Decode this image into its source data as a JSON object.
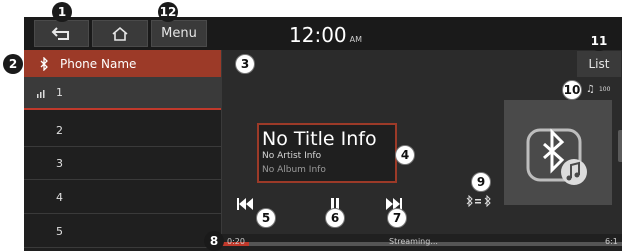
{
  "topbar": {
    "menu_label": "Menu",
    "clock": "12:00",
    "clock_suffix": "AM"
  },
  "source": {
    "phone_name": "Phone Name",
    "list_label": "List"
  },
  "tracks": [
    "1",
    "2",
    "3",
    "4",
    "5"
  ],
  "volume": {
    "value": "100"
  },
  "now_playing": {
    "title": "No Title Info",
    "artist": "No Artist Info",
    "album": "No Album Info"
  },
  "progress": {
    "time": "0:20",
    "status": "Streaming...",
    "end": "6:1",
    "fraction": 0.07
  },
  "callouts": [
    "1",
    "2",
    "3",
    "4",
    "5",
    "6",
    "7",
    "8",
    "9",
    "10",
    "11",
    "12"
  ],
  "colors": {
    "accent": "#c0392b",
    "selected_tab": "#9c3a28",
    "background": "#2b2b2b"
  }
}
